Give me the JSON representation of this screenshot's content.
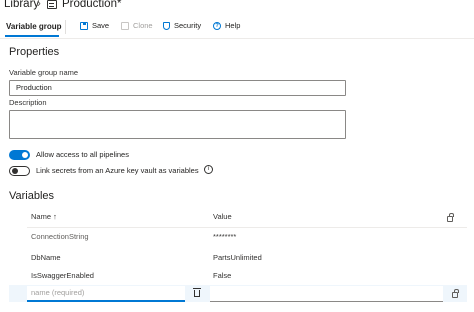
{
  "breadcrumb": {
    "library": "Library",
    "separator": "›",
    "title": "Production*"
  },
  "toolbar": {
    "active_tab": "Variable group",
    "save": "Save",
    "clone": "Clone",
    "security": "Security",
    "help": "Help"
  },
  "properties": {
    "heading": "Properties",
    "name_label": "Variable group name",
    "name_value": "Production",
    "description_label": "Description",
    "description_value": "",
    "toggle_pipelines": {
      "label": "Allow access to all pipelines",
      "on": true
    },
    "toggle_keyvault": {
      "label": "Link secrets from an Azure key vault as variables",
      "on": false
    }
  },
  "variables": {
    "heading": "Variables",
    "columns": {
      "name": "Name ↑",
      "value": "Value"
    },
    "rows": [
      {
        "name": "ConnectionString",
        "value": "********"
      },
      {
        "name": "DbName",
        "value": "PartsUnlimited"
      },
      {
        "name": "IsSwaggerEnabled",
        "value": "False"
      }
    ],
    "new_name_placeholder": "name (required)"
  },
  "colors": {
    "accent": "#0078d4",
    "text": "#201f1e",
    "border": "#8a8886",
    "new_row_bg": "#eff6fc"
  }
}
